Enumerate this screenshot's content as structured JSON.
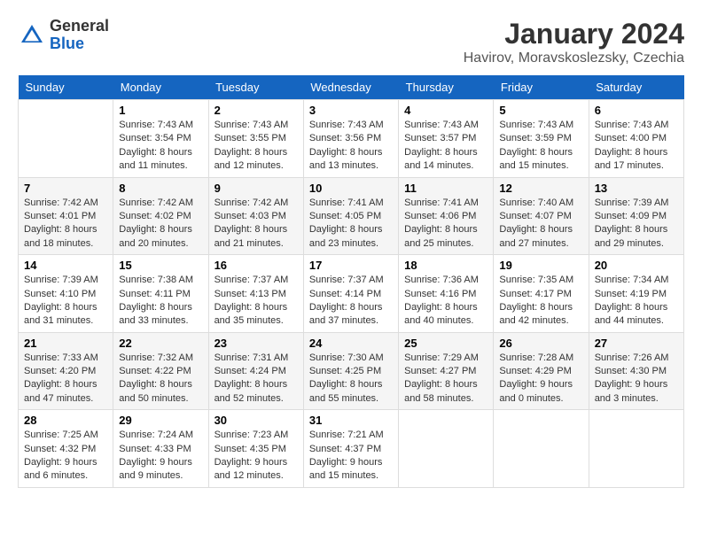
{
  "header": {
    "logo": {
      "line1": "General",
      "line2": "Blue"
    },
    "month": "January 2024",
    "location": "Havirov, Moravskoslezsky, Czechia"
  },
  "columns": [
    "Sunday",
    "Monday",
    "Tuesday",
    "Wednesday",
    "Thursday",
    "Friday",
    "Saturday"
  ],
  "weeks": [
    [
      {
        "day": "",
        "sunrise": "",
        "sunset": "",
        "daylight": ""
      },
      {
        "day": "1",
        "sunrise": "Sunrise: 7:43 AM",
        "sunset": "Sunset: 3:54 PM",
        "daylight": "Daylight: 8 hours and 11 minutes."
      },
      {
        "day": "2",
        "sunrise": "Sunrise: 7:43 AM",
        "sunset": "Sunset: 3:55 PM",
        "daylight": "Daylight: 8 hours and 12 minutes."
      },
      {
        "day": "3",
        "sunrise": "Sunrise: 7:43 AM",
        "sunset": "Sunset: 3:56 PM",
        "daylight": "Daylight: 8 hours and 13 minutes."
      },
      {
        "day": "4",
        "sunrise": "Sunrise: 7:43 AM",
        "sunset": "Sunset: 3:57 PM",
        "daylight": "Daylight: 8 hours and 14 minutes."
      },
      {
        "day": "5",
        "sunrise": "Sunrise: 7:43 AM",
        "sunset": "Sunset: 3:59 PM",
        "daylight": "Daylight: 8 hours and 15 minutes."
      },
      {
        "day": "6",
        "sunrise": "Sunrise: 7:43 AM",
        "sunset": "Sunset: 4:00 PM",
        "daylight": "Daylight: 8 hours and 17 minutes."
      }
    ],
    [
      {
        "day": "7",
        "sunrise": "Sunrise: 7:42 AM",
        "sunset": "Sunset: 4:01 PM",
        "daylight": "Daylight: 8 hours and 18 minutes."
      },
      {
        "day": "8",
        "sunrise": "Sunrise: 7:42 AM",
        "sunset": "Sunset: 4:02 PM",
        "daylight": "Daylight: 8 hours and 20 minutes."
      },
      {
        "day": "9",
        "sunrise": "Sunrise: 7:42 AM",
        "sunset": "Sunset: 4:03 PM",
        "daylight": "Daylight: 8 hours and 21 minutes."
      },
      {
        "day": "10",
        "sunrise": "Sunrise: 7:41 AM",
        "sunset": "Sunset: 4:05 PM",
        "daylight": "Daylight: 8 hours and 23 minutes."
      },
      {
        "day": "11",
        "sunrise": "Sunrise: 7:41 AM",
        "sunset": "Sunset: 4:06 PM",
        "daylight": "Daylight: 8 hours and 25 minutes."
      },
      {
        "day": "12",
        "sunrise": "Sunrise: 7:40 AM",
        "sunset": "Sunset: 4:07 PM",
        "daylight": "Daylight: 8 hours and 27 minutes."
      },
      {
        "day": "13",
        "sunrise": "Sunrise: 7:39 AM",
        "sunset": "Sunset: 4:09 PM",
        "daylight": "Daylight: 8 hours and 29 minutes."
      }
    ],
    [
      {
        "day": "14",
        "sunrise": "Sunrise: 7:39 AM",
        "sunset": "Sunset: 4:10 PM",
        "daylight": "Daylight: 8 hours and 31 minutes."
      },
      {
        "day": "15",
        "sunrise": "Sunrise: 7:38 AM",
        "sunset": "Sunset: 4:11 PM",
        "daylight": "Daylight: 8 hours and 33 minutes."
      },
      {
        "day": "16",
        "sunrise": "Sunrise: 7:37 AM",
        "sunset": "Sunset: 4:13 PM",
        "daylight": "Daylight: 8 hours and 35 minutes."
      },
      {
        "day": "17",
        "sunrise": "Sunrise: 7:37 AM",
        "sunset": "Sunset: 4:14 PM",
        "daylight": "Daylight: 8 hours and 37 minutes."
      },
      {
        "day": "18",
        "sunrise": "Sunrise: 7:36 AM",
        "sunset": "Sunset: 4:16 PM",
        "daylight": "Daylight: 8 hours and 40 minutes."
      },
      {
        "day": "19",
        "sunrise": "Sunrise: 7:35 AM",
        "sunset": "Sunset: 4:17 PM",
        "daylight": "Daylight: 8 hours and 42 minutes."
      },
      {
        "day": "20",
        "sunrise": "Sunrise: 7:34 AM",
        "sunset": "Sunset: 4:19 PM",
        "daylight": "Daylight: 8 hours and 44 minutes."
      }
    ],
    [
      {
        "day": "21",
        "sunrise": "Sunrise: 7:33 AM",
        "sunset": "Sunset: 4:20 PM",
        "daylight": "Daylight: 8 hours and 47 minutes."
      },
      {
        "day": "22",
        "sunrise": "Sunrise: 7:32 AM",
        "sunset": "Sunset: 4:22 PM",
        "daylight": "Daylight: 8 hours and 50 minutes."
      },
      {
        "day": "23",
        "sunrise": "Sunrise: 7:31 AM",
        "sunset": "Sunset: 4:24 PM",
        "daylight": "Daylight: 8 hours and 52 minutes."
      },
      {
        "day": "24",
        "sunrise": "Sunrise: 7:30 AM",
        "sunset": "Sunset: 4:25 PM",
        "daylight": "Daylight: 8 hours and 55 minutes."
      },
      {
        "day": "25",
        "sunrise": "Sunrise: 7:29 AM",
        "sunset": "Sunset: 4:27 PM",
        "daylight": "Daylight: 8 hours and 58 minutes."
      },
      {
        "day": "26",
        "sunrise": "Sunrise: 7:28 AM",
        "sunset": "Sunset: 4:29 PM",
        "daylight": "Daylight: 9 hours and 0 minutes."
      },
      {
        "day": "27",
        "sunrise": "Sunrise: 7:26 AM",
        "sunset": "Sunset: 4:30 PM",
        "daylight": "Daylight: 9 hours and 3 minutes."
      }
    ],
    [
      {
        "day": "28",
        "sunrise": "Sunrise: 7:25 AM",
        "sunset": "Sunset: 4:32 PM",
        "daylight": "Daylight: 9 hours and 6 minutes."
      },
      {
        "day": "29",
        "sunrise": "Sunrise: 7:24 AM",
        "sunset": "Sunset: 4:33 PM",
        "daylight": "Daylight: 9 hours and 9 minutes."
      },
      {
        "day": "30",
        "sunrise": "Sunrise: 7:23 AM",
        "sunset": "Sunset: 4:35 PM",
        "daylight": "Daylight: 9 hours and 12 minutes."
      },
      {
        "day": "31",
        "sunrise": "Sunrise: 7:21 AM",
        "sunset": "Sunset: 4:37 PM",
        "daylight": "Daylight: 9 hours and 15 minutes."
      },
      {
        "day": "",
        "sunrise": "",
        "sunset": "",
        "daylight": ""
      },
      {
        "day": "",
        "sunrise": "",
        "sunset": "",
        "daylight": ""
      },
      {
        "day": "",
        "sunrise": "",
        "sunset": "",
        "daylight": ""
      }
    ]
  ]
}
